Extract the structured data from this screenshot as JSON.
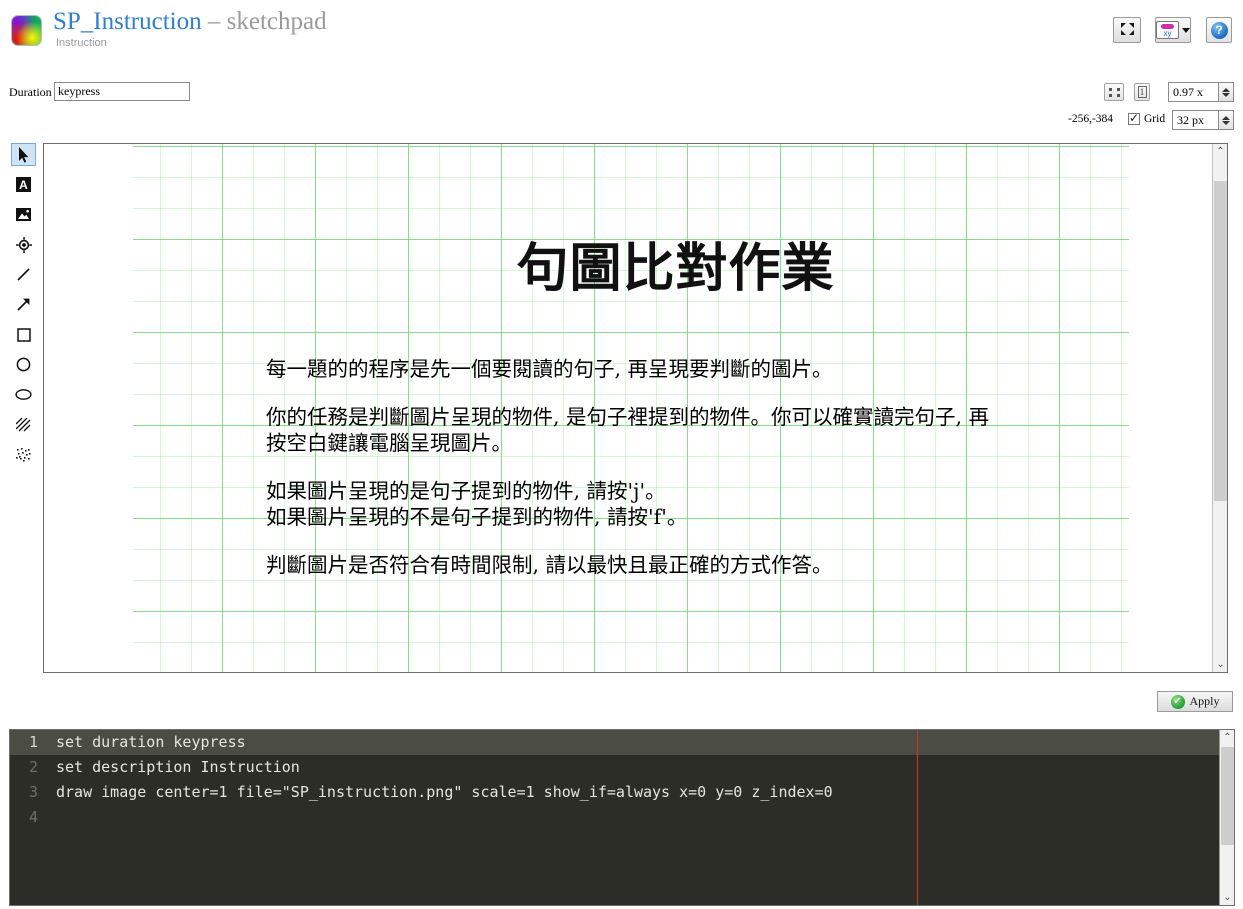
{
  "header": {
    "logo_icon": "color-wheel-icon",
    "title_main": "SP_Instruction",
    "title_dash": " – ",
    "title_sub": "sketchpad",
    "description": "Instruction",
    "buttons": {
      "fullscreen": {
        "icon": "fullscreen-icon",
        "label": ""
      },
      "xy": {
        "icon": "xy-variables-icon",
        "label": "xy"
      },
      "help": {
        "icon": "help-icon",
        "label": "?"
      }
    }
  },
  "properties": {
    "duration_label": "Duration",
    "duration_value": "keypress",
    "duration_placeholder": "duration",
    "fit_view_icon": "fit-view-icon",
    "zoom_reset_label": "1",
    "zoom_value": "0.97 x",
    "coords": "-256,-384",
    "grid_label": "Grid",
    "grid_checked": true,
    "grid_size": "32 px"
  },
  "tools": [
    {
      "name": "select-tool",
      "icon": "cursor-arrow-icon",
      "glyph": "➤",
      "active": true
    },
    {
      "name": "text-tool",
      "icon": "text-a-icon",
      "glyph": "A",
      "active": false
    },
    {
      "name": "image-tool",
      "icon": "image-icon",
      "glyph": "▣",
      "active": false
    },
    {
      "name": "target-tool",
      "icon": "target-icon",
      "glyph": "◉",
      "active": false
    },
    {
      "name": "line-tool",
      "icon": "line-icon",
      "glyph": "／",
      "active": false
    },
    {
      "name": "arrow-tool",
      "icon": "arrow-icon",
      "glyph": "↗",
      "active": false
    },
    {
      "name": "rectangle-tool",
      "icon": "rectangle-icon",
      "glyph": "□",
      "active": false
    },
    {
      "name": "circle-tool",
      "icon": "circle-icon",
      "glyph": "○",
      "active": false
    },
    {
      "name": "ellipse-tool",
      "icon": "ellipse-icon",
      "glyph": "⬭",
      "active": false
    },
    {
      "name": "hatch-tool",
      "icon": "hatch-pattern-icon",
      "glyph": "▨",
      "active": false
    },
    {
      "name": "noise-tool",
      "icon": "noise-dots-icon",
      "glyph": "⣿",
      "active": false
    }
  ],
  "canvas": {
    "doc_title": "句圖比對作業",
    "paragraphs": [
      "每一題的的程序是先一個要閱讀的句子, 再呈現要判斷的圖片。",
      "你的任務是判斷圖片呈現的物件, 是句子裡提到的物件。你可以確實讀完句子, 再",
      "按空白鍵讓電腦呈現圖片。",
      "如果圖片呈現的是句子提到的物件, 請按'j'。",
      "如果圖片呈現的不是句子提到的物件, 請按'f'。",
      "判斷圖片是否符合有時間限制, 請以最快且最正確的方式作答。"
    ],
    "scroll_up_icon": "chevron-up-icon",
    "scroll_down_icon": "chevron-down-icon"
  },
  "apply": {
    "label": "Apply",
    "icon": "green-check-icon",
    "glyph": "✔"
  },
  "editor": {
    "line_numbers": [
      "1",
      "2",
      "3",
      "4"
    ],
    "lines": [
      "set duration keypress",
      "set description Instruction",
      "draw image center=1 file=\"SP_instruction.png\" scale=1 show_if=always x=0 y=0 z_index=0",
      ""
    ],
    "current_line": 1,
    "scroll_up_icon": "chevron-up-icon",
    "scroll_down_icon": "chevron-down-icon"
  },
  "colors": {
    "accent_blue": "#2f7fd0",
    "muted_gray": "#9a9a9a",
    "grid_green": "#78dc78",
    "editor_bg": "#2b2d26",
    "caret_red": "#d2322d",
    "apply_green": "#17992b"
  }
}
